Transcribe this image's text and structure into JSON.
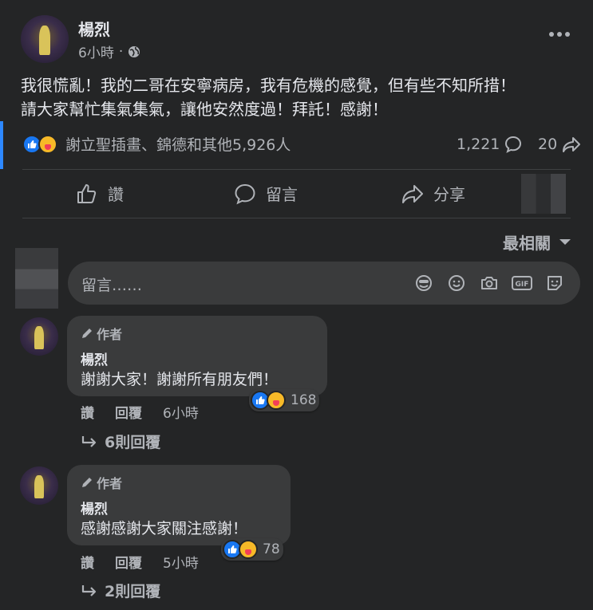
{
  "post": {
    "author": "楊烈",
    "time": "6小時",
    "text_line1": "我很慌亂！我的二哥在安寧病房，我有危機的感覺，但有些不知所措！",
    "text_line2": "請大家幫忙集氣集氣，讓他安然度過！拜託！感謝！",
    "reactions_text": "謝立聖插畫、錦德和其他5,926人",
    "comment_count": "1,221",
    "share_count": "20"
  },
  "actions": {
    "like": "讚",
    "comment": "留言",
    "share": "分享"
  },
  "sort_label": "最相關",
  "comment_input": {
    "placeholder": "留言……"
  },
  "comments": [
    {
      "badge": "作者",
      "author": "楊烈",
      "text": "謝謝大家！謝謝所有朋友們！",
      "reaction_count": "168",
      "like": "讚",
      "reply": "回覆",
      "time": "6小時",
      "replies": "6則回覆"
    },
    {
      "badge": "作者",
      "author": "楊烈",
      "text": "感謝感謝大家關注感謝！",
      "reaction_count": "78",
      "like": "讚",
      "reply": "回覆",
      "time": "5小時",
      "replies": "2則回覆"
    }
  ],
  "colors": {
    "background": "#242526",
    "bubble": "#3a3b3c",
    "like_blue": "#1877f2",
    "care_yellow": "#f7b928",
    "accent_bar": "#2d88ff"
  }
}
